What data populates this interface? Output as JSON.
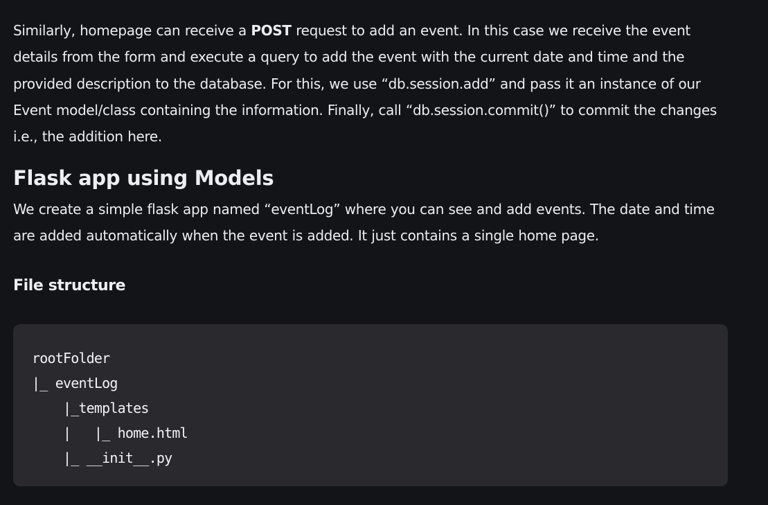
{
  "article": {
    "paragraph1": {
      "before_bold": "Similarly, homepage can receive a ",
      "bold": "POST",
      "after_bold": " request to add an event. In this case we receive the event details from the form and execute a query to add the event with the current date and time and the provided description to the database. For this, we use “db.session.add” and pass it an instance of our Event model/class containing the information. Finally, call “db.session.commit()” to commit the changes i.e., the addition here."
    },
    "heading": "Flask app using Models",
    "paragraph2": "We create a simple flask app named “eventLog” where you can see and add events. The date and time are added automatically when the event is added. It just contains a single home page.",
    "subheading": "File structure",
    "code_lines": [
      "rootFolder",
      "|_ eventLog",
      "    |_templates",
      "    |   |_ home.html",
      "    |_ __init__.py"
    ]
  }
}
